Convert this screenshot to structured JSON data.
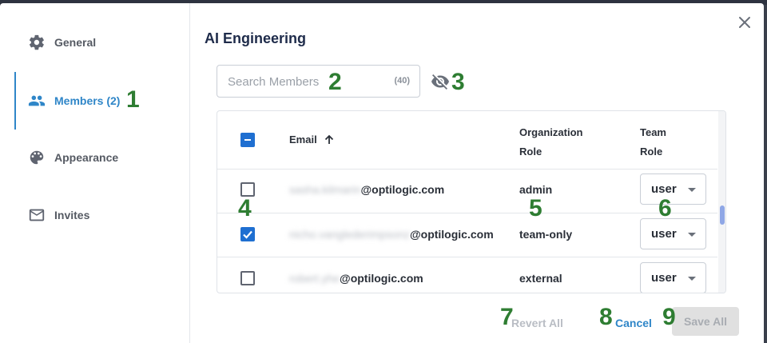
{
  "dialog": {
    "title": "AI Engineering",
    "close_icon": "close-icon"
  },
  "sidebar": {
    "items": [
      {
        "label": "General",
        "icon": "gear-icon",
        "active": false
      },
      {
        "label": "Members (2)",
        "icon": "people-icon",
        "active": true
      },
      {
        "label": "Appearance",
        "icon": "palette-icon",
        "active": false
      },
      {
        "label": "Invites",
        "icon": "mail-icon",
        "active": false
      }
    ]
  },
  "search": {
    "placeholder": "Search Members",
    "value": "",
    "count": "(40)",
    "visibility_icon": "eye-off-icon"
  },
  "table": {
    "headers": {
      "email": "Email",
      "org_role_line1": "Organization",
      "org_role_line2": "Role",
      "team_role_line1": "Team",
      "team_role_line2": "Role",
      "sort_icon": "arrow-up-icon"
    },
    "header_checkbox": "indeterminate",
    "rows": [
      {
        "email_hidden": "sasha.kilmarin",
        "email_domain": "@optilogic.com",
        "org_role": "admin",
        "team_role": "user",
        "checked": false
      },
      {
        "email_hidden": "nicho.vanglederimpsonz",
        "email_domain": "@optilogic.com",
        "org_role": "team-only",
        "team_role": "user",
        "checked": true
      },
      {
        "email_hidden": "robert.yhe",
        "email_domain": "@optilogic.com",
        "org_role": "external",
        "team_role": "user",
        "checked": false
      }
    ]
  },
  "footer": {
    "revert_label": "Revert All",
    "cancel_label": "Cancel",
    "save_label": "Save All"
  },
  "annotations": [
    "1",
    "2",
    "3",
    "4",
    "5",
    "6",
    "7",
    "8",
    "9"
  ],
  "colors": {
    "accent": "#2f86c8",
    "checkbox": "#1f6fd1",
    "annotation": "#2e7d32"
  }
}
